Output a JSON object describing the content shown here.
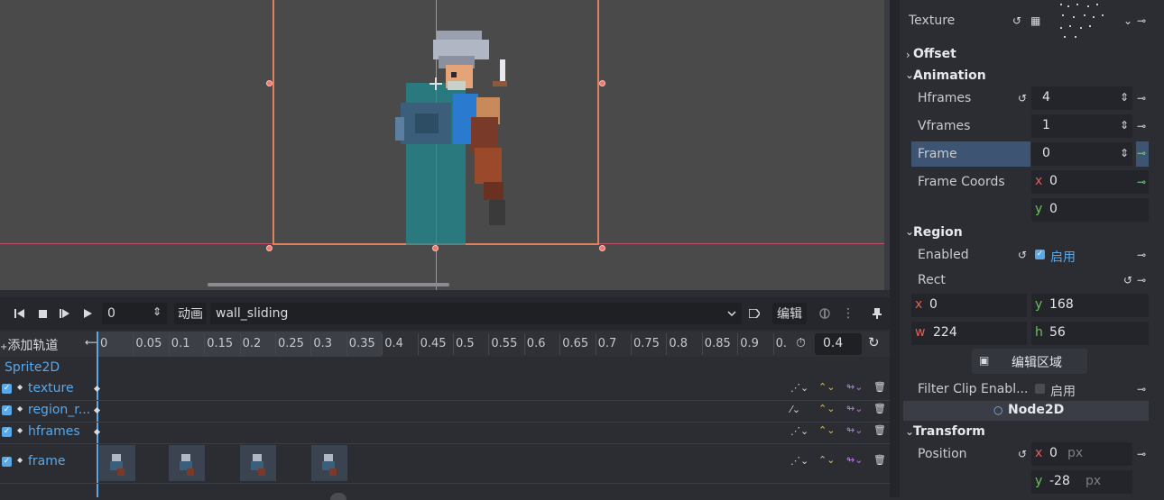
{
  "timeline_toolbar": {
    "frame_value": "0",
    "animation_label": "动画",
    "animation_name": "wall_sliding",
    "edit_label": "编辑"
  },
  "timeline": {
    "add_track": "添加轨道",
    "ticks": [
      "0",
      "0.05",
      "0.1",
      "0.15",
      "0.2",
      "0.25",
      "0.3",
      "0.35",
      "0.4",
      "0.45",
      "0.5",
      "0.55",
      "0.6",
      "0.65",
      "0.7",
      "0.75",
      "0.8",
      "0.85",
      "0.9",
      "0."
    ],
    "length_value": "0.4",
    "node_name": "Sprite2D",
    "tracks": [
      {
        "label": "texture"
      },
      {
        "label": "region_r..."
      },
      {
        "label": "hframes"
      },
      {
        "label": "frame"
      }
    ]
  },
  "inspector": {
    "texture_label": "Texture",
    "offset_header": "Offset",
    "animation_header": "Animation",
    "hframes_label": "Hframes",
    "hframes_value": "4",
    "vframes_label": "Vframes",
    "vframes_value": "1",
    "frame_label": "Frame",
    "frame_value": "0",
    "frame_coords_label": "Frame Coords",
    "frame_coords": {
      "x_axis": "x",
      "x": "0",
      "y_axis": "y",
      "y": "0"
    },
    "region_header": "Region",
    "enabled_label": "Enabled",
    "enabled_value": "启用",
    "rect_label": "Rect",
    "rect": {
      "x_axis": "x",
      "x": "0",
      "y_axis": "y",
      "y": "168",
      "w_axis": "w",
      "w": "224",
      "h_axis": "h",
      "h": "56"
    },
    "edit_region_button": "编辑区域",
    "filter_clip_label": "Filter Clip Enabl...",
    "filter_clip_value": "启用",
    "node2d_header": "Node2D",
    "transform_header": "Transform",
    "position_label": "Position",
    "position": {
      "x_axis": "x",
      "x": "0",
      "x_unit": "px",
      "y_axis": "y",
      "y": "-28",
      "y_unit": "px"
    }
  },
  "colors": {
    "accent": "#5aa8e8",
    "selection_rect": "#f2786e",
    "frame_row_highlight": "#3d5573"
  }
}
